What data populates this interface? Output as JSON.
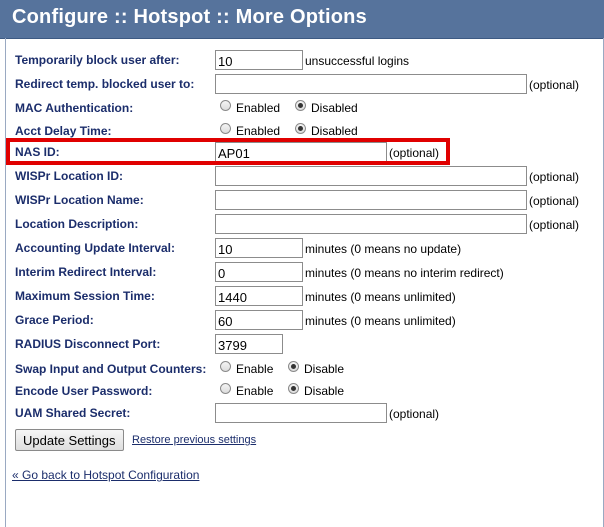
{
  "header": {
    "title": "Configure :: Hotspot :: More Options"
  },
  "fields": {
    "block_after": {
      "label": "Temporarily block user after:",
      "value": "10",
      "note": "unsuccessful logins"
    },
    "redirect_blocked": {
      "label": "Redirect temp. blocked user to:",
      "value": "",
      "note": "(optional)"
    },
    "mac_auth": {
      "label": "MAC Authentication:",
      "opt1": "Enabled",
      "opt2": "Disabled",
      "selected": "Disabled"
    },
    "acct_delay": {
      "label": "Acct Delay Time:",
      "opt1": "Enabled",
      "opt2": "Disabled",
      "selected": "Disabled"
    },
    "nas_id": {
      "label": "NAS ID:",
      "value": "AP01",
      "note": "(optional)"
    },
    "wispr_loc_id": {
      "label": "WISPr Location ID:",
      "value": "",
      "note": "(optional)"
    },
    "wispr_loc_name": {
      "label": "WISPr Location Name:",
      "value": "",
      "note": "(optional)"
    },
    "loc_desc": {
      "label": "Location Description:",
      "value": "",
      "note": "(optional)"
    },
    "acct_interval": {
      "label": "Accounting Update Interval:",
      "value": "10",
      "note": "minutes (0 means no update)"
    },
    "interim_redirect": {
      "label": "Interim Redirect Interval:",
      "value": "0",
      "note": "minutes (0 means no interim redirect)"
    },
    "max_session": {
      "label": "Maximum Session Time:",
      "value": "1440",
      "note": "minutes (0 means unlimited)"
    },
    "grace": {
      "label": "Grace Period:",
      "value": "60",
      "note": "minutes (0 means unlimited)"
    },
    "radius_port": {
      "label": "RADIUS Disconnect Port:",
      "value": "3799"
    },
    "swap_counters": {
      "label": "Swap Input and Output Counters:",
      "opt1": "Enable",
      "opt2": "Disable",
      "selected": "Disable"
    },
    "encode_pw": {
      "label": "Encode User Password:",
      "opt1": "Enable",
      "opt2": "Disable",
      "selected": "Disable"
    },
    "uam_secret": {
      "label": "UAM Shared Secret:",
      "value": "",
      "note": "(optional)"
    }
  },
  "actions": {
    "update_label": "Update Settings",
    "restore_label": "Restore previous settings",
    "back_label": "« Go back to Hotspot Configuration"
  },
  "colors": {
    "header_bg": "#56739c",
    "label_text": "#1b2d6b",
    "highlight": "#e00000"
  }
}
